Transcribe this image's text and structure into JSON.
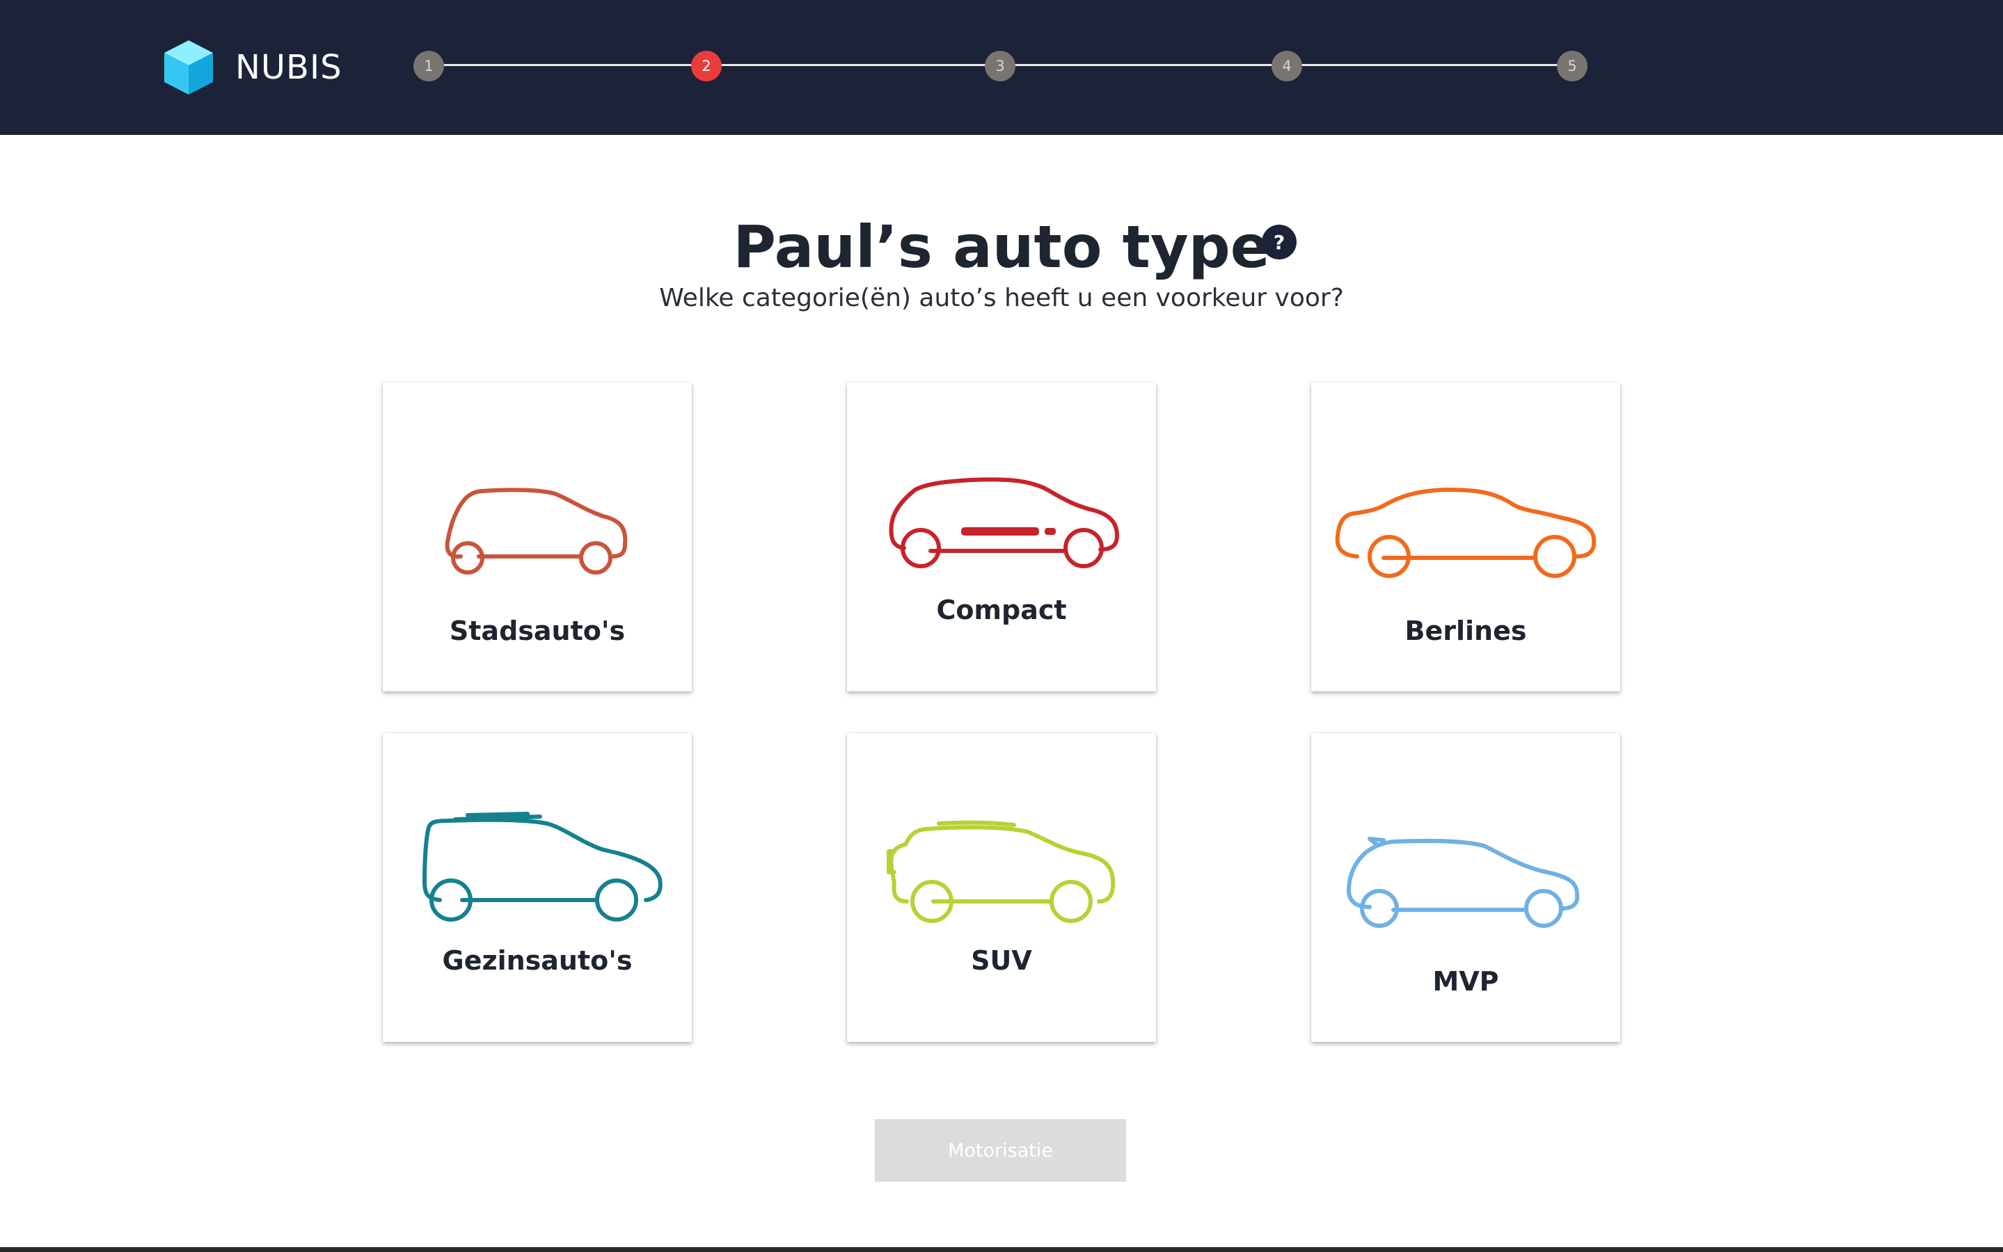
{
  "header": {
    "brand": "NUBIS",
    "steps": [
      {
        "label": "1",
        "state": "done"
      },
      {
        "label": "2",
        "state": "active"
      },
      {
        "label": "3",
        "state": "upcoming"
      },
      {
        "label": "4",
        "state": "upcoming"
      },
      {
        "label": "5",
        "state": "upcoming"
      }
    ],
    "colors": {
      "background": "#1c2237",
      "active_step": "#ea3d3b",
      "inactive_step": "#7a7471",
      "logo": "#3fd0f5"
    }
  },
  "main": {
    "title": "Paul’s auto type",
    "help_icon": "?",
    "subtitle": "Welke categorie(ën) auto’s heeft u een voorkeur voor?",
    "categories": [
      {
        "label": "Stadsauto's",
        "icon": "hatchback-car-icon",
        "color": "#c8553a"
      },
      {
        "label": "Compact",
        "icon": "compact-car-icon",
        "color": "#c8222a"
      },
      {
        "label": "Berlines",
        "icon": "sedan-car-icon",
        "color": "#f26a1b"
      },
      {
        "label": "Gezinsauto's",
        "icon": "family-car-icon",
        "color": "#15818f"
      },
      {
        "label": "SUV",
        "icon": "suv-car-icon",
        "color": "#b5d334"
      },
      {
        "label": "MVP",
        "icon": "mpv-car-icon",
        "color": "#6fb1e4"
      }
    ],
    "next_button": "Motorisatie"
  }
}
